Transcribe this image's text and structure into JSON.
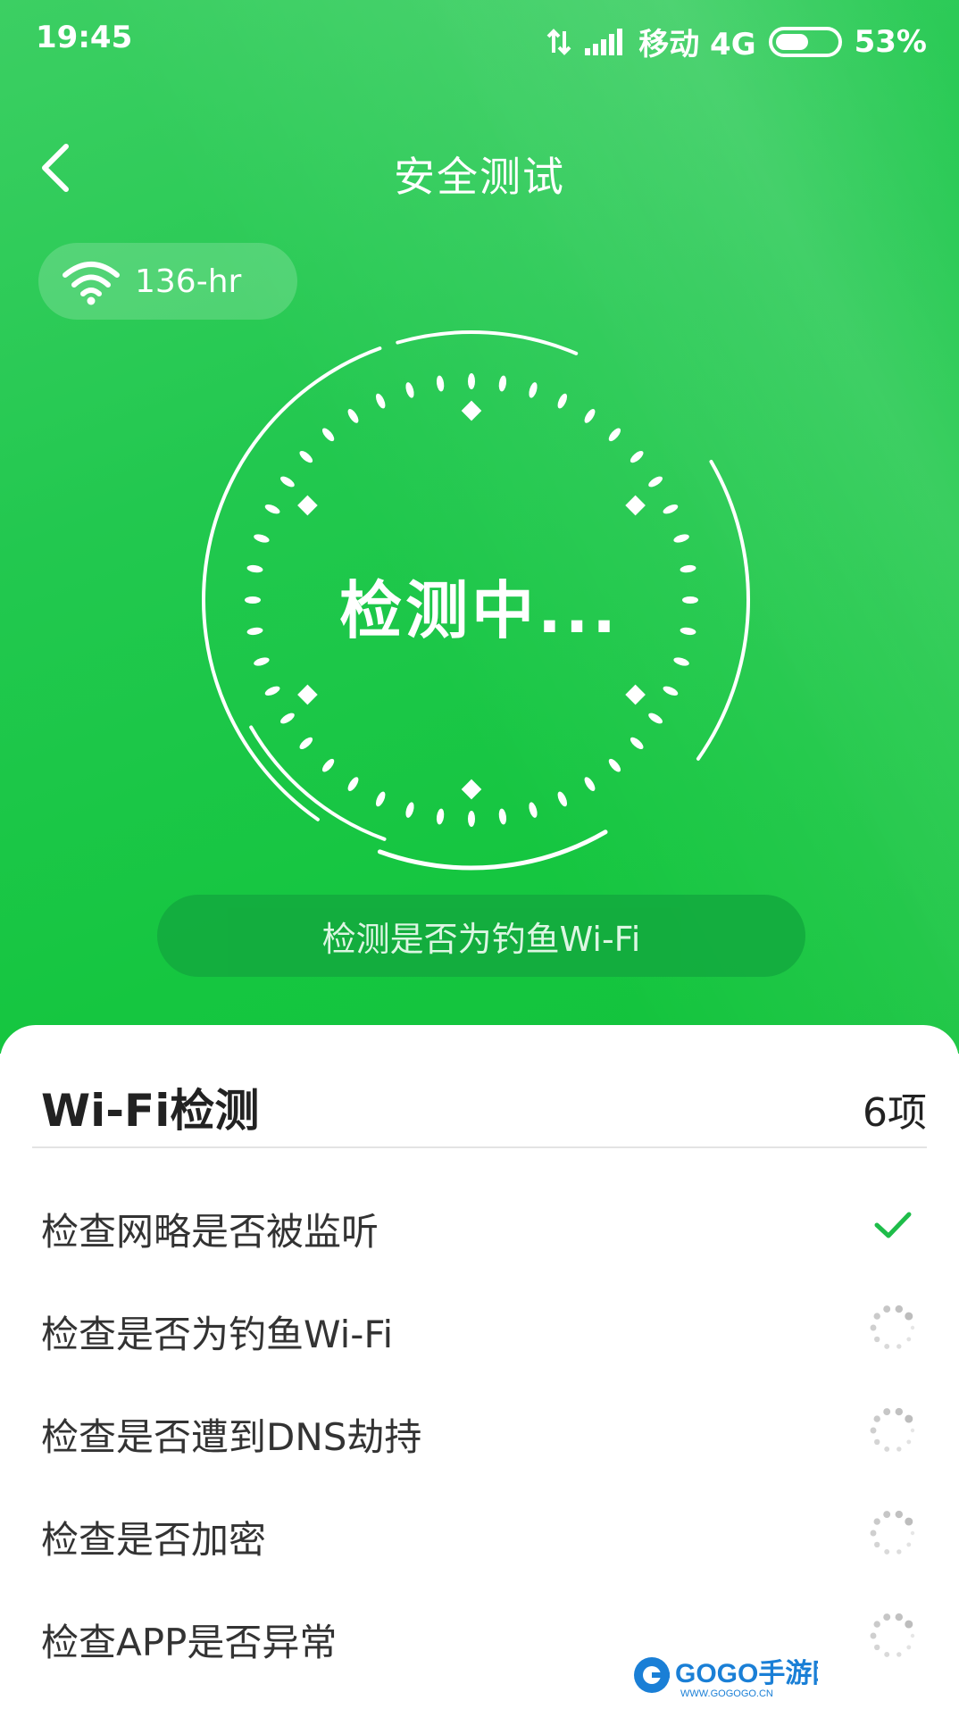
{
  "status_bar": {
    "time": "19:45",
    "carrier": "移动 4G",
    "battery": "53%",
    "battery_level": 0.53
  },
  "nav": {
    "title": "安全测试",
    "back_icon": "back-chevron-icon"
  },
  "wifi": {
    "name": "136-hr",
    "icon": "wifi-icon"
  },
  "scanner": {
    "status_text": "检测中...",
    "current_step": "检测是否为钓鱼Wi-Fi"
  },
  "checks": {
    "title": "Wi-Fi检测",
    "count": "6项",
    "items": [
      {
        "label": "检查网略是否被监听",
        "state": "done"
      },
      {
        "label": "检查是否为钓鱼Wi-Fi",
        "state": "loading"
      },
      {
        "label": "检查是否遭到DNS劫持",
        "state": "loading"
      },
      {
        "label": "检查是否加密",
        "state": "loading"
      },
      {
        "label": "检查APP是否异常",
        "state": "loading"
      }
    ]
  },
  "watermark": {
    "text": "GOGO手游网",
    "subtext": "WWW.GOGOGO.CN"
  },
  "colors": {
    "accent": "#1ec64a",
    "check": "#1ebd4a",
    "spinner": "#b8b8b8"
  }
}
